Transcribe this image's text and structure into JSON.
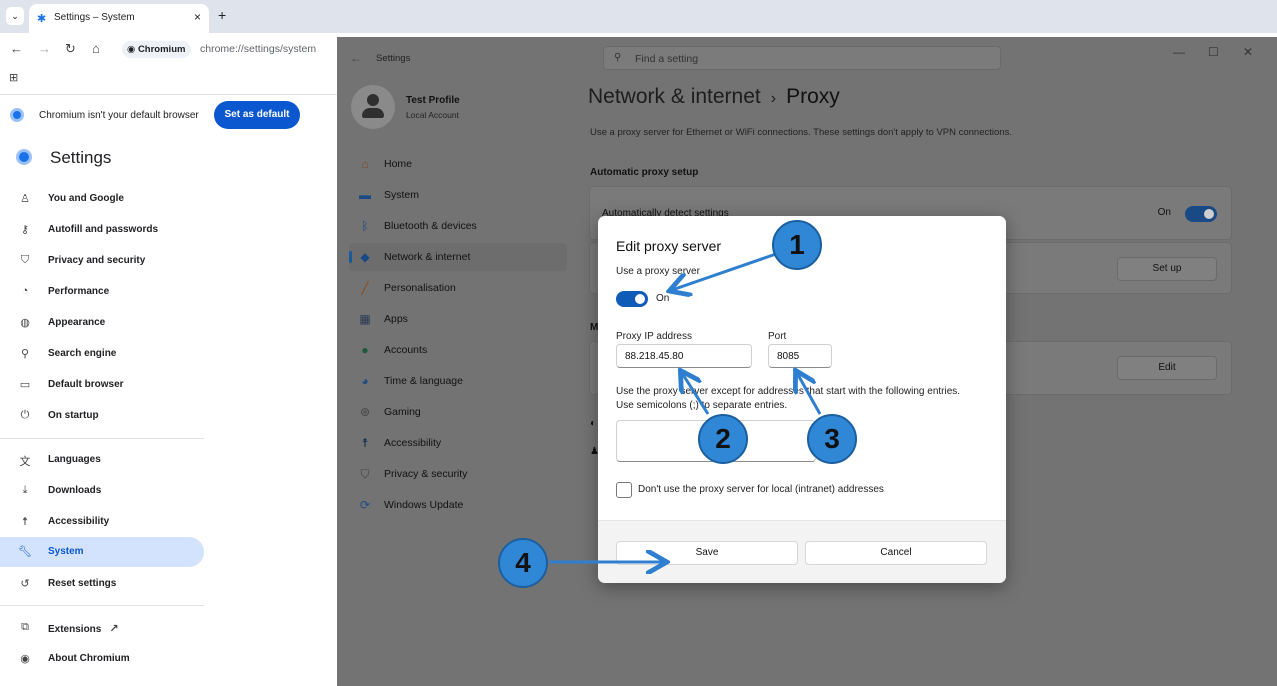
{
  "browser": {
    "tab_title": "Settings – System",
    "chip_label": "Chromium",
    "url": "chrome://settings/system",
    "default_banner_text": "Chromium isn't your default browser",
    "set_default_label": "Set as default"
  },
  "chromium_settings": {
    "title": "Settings",
    "items": [
      {
        "label": "You and Google",
        "icon": "person-icon"
      },
      {
        "label": "Autofill and passwords",
        "icon": "key-icon"
      },
      {
        "label": "Privacy and security",
        "icon": "shield-icon"
      },
      {
        "label": "Performance",
        "icon": "gauge-icon"
      },
      {
        "label": "Appearance",
        "icon": "palette-icon"
      },
      {
        "label": "Search engine",
        "icon": "search-icon"
      },
      {
        "label": "Default browser",
        "icon": "browser-icon"
      },
      {
        "label": "On startup",
        "icon": "power-icon"
      },
      {
        "label": "Languages",
        "icon": "translate-icon"
      },
      {
        "label": "Downloads",
        "icon": "download-icon"
      },
      {
        "label": "Accessibility",
        "icon": "accessibility-icon"
      },
      {
        "label": "System",
        "icon": "wrench-icon"
      },
      {
        "label": "Reset settings",
        "icon": "reset-icon"
      },
      {
        "label": "Extensions",
        "icon": "puzzle-icon"
      },
      {
        "label": "About Chromium",
        "icon": "chromium-icon"
      }
    ],
    "active": "System"
  },
  "windows_settings": {
    "window_title": "Settings",
    "search_placeholder": "Find a setting",
    "profile_name": "Test Profile",
    "profile_sub": "Local Account",
    "nav": [
      {
        "label": "Home",
        "icon": "home-icon"
      },
      {
        "label": "System",
        "icon": "monitor-icon"
      },
      {
        "label": "Bluetooth & devices",
        "icon": "bluetooth-icon"
      },
      {
        "label": "Network & internet",
        "icon": "wifi-icon"
      },
      {
        "label": "Personalisation",
        "icon": "brush-icon"
      },
      {
        "label": "Apps",
        "icon": "apps-icon"
      },
      {
        "label": "Accounts",
        "icon": "account-icon"
      },
      {
        "label": "Time & language",
        "icon": "globe-clock-icon"
      },
      {
        "label": "Gaming",
        "icon": "gamepad-icon"
      },
      {
        "label": "Accessibility",
        "icon": "accessibility-icon"
      },
      {
        "label": "Privacy & security",
        "icon": "shield-icon"
      },
      {
        "label": "Windows Update",
        "icon": "update-icon"
      }
    ],
    "active_nav": "Network & internet",
    "breadcrumb_parent": "Network & internet",
    "breadcrumb_sep": "›",
    "breadcrumb_current": "Proxy",
    "description": "Use a proxy server for Ethernet or WiFi connections. These settings don't apply to VPN connections.",
    "auto_section": "Automatic proxy setup",
    "auto_detect_label": "Automatically detect settings",
    "auto_detect_state": "On",
    "setup_button": "Set up",
    "manual_section_initial": "M",
    "edit_button": "Edit"
  },
  "dialog": {
    "title": "Edit proxy server",
    "use_proxy_label": "Use a proxy server",
    "use_proxy_state": "On",
    "ip_label": "Proxy IP address",
    "ip_value": "88.218.45.80",
    "port_label": "Port",
    "port_value": "8085",
    "exceptions_line1": "Use the proxy server except for addresses that start with the following entries.",
    "exceptions_line2": "Use semicolons (;) to separate entries.",
    "exceptions_value": "",
    "local_checkbox_label": "Don't use the proxy server for local (intranet) addresses",
    "local_checkbox_checked": false,
    "save_label": "Save",
    "cancel_label": "Cancel"
  },
  "annotations": [
    {
      "number": "1",
      "target": "use-proxy-toggle"
    },
    {
      "number": "2",
      "target": "proxy-ip-input"
    },
    {
      "number": "3",
      "target": "port-input"
    },
    {
      "number": "4",
      "target": "save-button"
    }
  ],
  "colors": {
    "chromium_accent": "#0b57d0",
    "annotation_badge": "#2f87d6",
    "windows_toggle_on": "#0f5cb8"
  }
}
